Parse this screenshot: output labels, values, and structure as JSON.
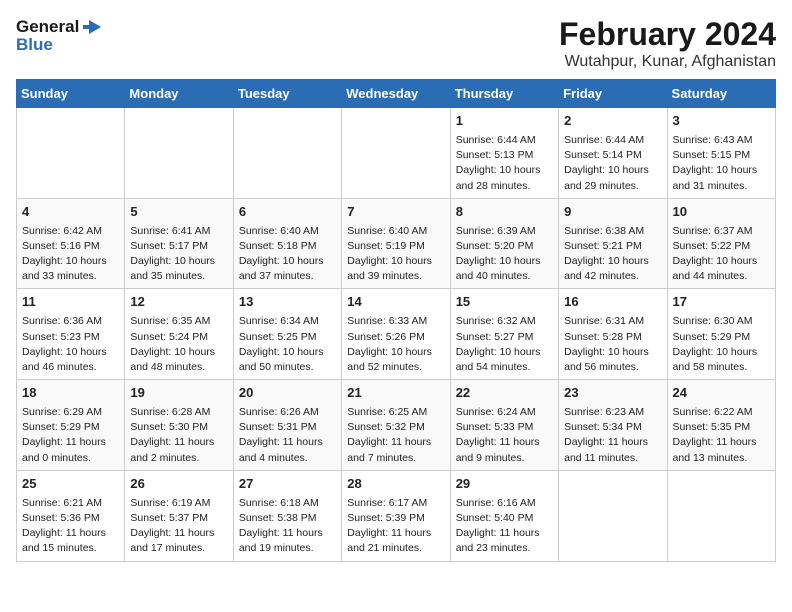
{
  "header": {
    "logo_line1": "General",
    "logo_line2": "Blue",
    "title": "February 2024",
    "subtitle": "Wutahpur, Kunar, Afghanistan"
  },
  "days_of_week": [
    "Sunday",
    "Monday",
    "Tuesday",
    "Wednesday",
    "Thursday",
    "Friday",
    "Saturday"
  ],
  "weeks": [
    [
      {
        "day": "",
        "sunrise": "",
        "sunset": "",
        "daylight": ""
      },
      {
        "day": "",
        "sunrise": "",
        "sunset": "",
        "daylight": ""
      },
      {
        "day": "",
        "sunrise": "",
        "sunset": "",
        "daylight": ""
      },
      {
        "day": "",
        "sunrise": "",
        "sunset": "",
        "daylight": ""
      },
      {
        "day": "1",
        "sunrise": "Sunrise: 6:44 AM",
        "sunset": "Sunset: 5:13 PM",
        "daylight": "Daylight: 10 hours and 28 minutes."
      },
      {
        "day": "2",
        "sunrise": "Sunrise: 6:44 AM",
        "sunset": "Sunset: 5:14 PM",
        "daylight": "Daylight: 10 hours and 29 minutes."
      },
      {
        "day": "3",
        "sunrise": "Sunrise: 6:43 AM",
        "sunset": "Sunset: 5:15 PM",
        "daylight": "Daylight: 10 hours and 31 minutes."
      }
    ],
    [
      {
        "day": "4",
        "sunrise": "Sunrise: 6:42 AM",
        "sunset": "Sunset: 5:16 PM",
        "daylight": "Daylight: 10 hours and 33 minutes."
      },
      {
        "day": "5",
        "sunrise": "Sunrise: 6:41 AM",
        "sunset": "Sunset: 5:17 PM",
        "daylight": "Daylight: 10 hours and 35 minutes."
      },
      {
        "day": "6",
        "sunrise": "Sunrise: 6:40 AM",
        "sunset": "Sunset: 5:18 PM",
        "daylight": "Daylight: 10 hours and 37 minutes."
      },
      {
        "day": "7",
        "sunrise": "Sunrise: 6:40 AM",
        "sunset": "Sunset: 5:19 PM",
        "daylight": "Daylight: 10 hours and 39 minutes."
      },
      {
        "day": "8",
        "sunrise": "Sunrise: 6:39 AM",
        "sunset": "Sunset: 5:20 PM",
        "daylight": "Daylight: 10 hours and 40 minutes."
      },
      {
        "day": "9",
        "sunrise": "Sunrise: 6:38 AM",
        "sunset": "Sunset: 5:21 PM",
        "daylight": "Daylight: 10 hours and 42 minutes."
      },
      {
        "day": "10",
        "sunrise": "Sunrise: 6:37 AM",
        "sunset": "Sunset: 5:22 PM",
        "daylight": "Daylight: 10 hours and 44 minutes."
      }
    ],
    [
      {
        "day": "11",
        "sunrise": "Sunrise: 6:36 AM",
        "sunset": "Sunset: 5:23 PM",
        "daylight": "Daylight: 10 hours and 46 minutes."
      },
      {
        "day": "12",
        "sunrise": "Sunrise: 6:35 AM",
        "sunset": "Sunset: 5:24 PM",
        "daylight": "Daylight: 10 hours and 48 minutes."
      },
      {
        "day": "13",
        "sunrise": "Sunrise: 6:34 AM",
        "sunset": "Sunset: 5:25 PM",
        "daylight": "Daylight: 10 hours and 50 minutes."
      },
      {
        "day": "14",
        "sunrise": "Sunrise: 6:33 AM",
        "sunset": "Sunset: 5:26 PM",
        "daylight": "Daylight: 10 hours and 52 minutes."
      },
      {
        "day": "15",
        "sunrise": "Sunrise: 6:32 AM",
        "sunset": "Sunset: 5:27 PM",
        "daylight": "Daylight: 10 hours and 54 minutes."
      },
      {
        "day": "16",
        "sunrise": "Sunrise: 6:31 AM",
        "sunset": "Sunset: 5:28 PM",
        "daylight": "Daylight: 10 hours and 56 minutes."
      },
      {
        "day": "17",
        "sunrise": "Sunrise: 6:30 AM",
        "sunset": "Sunset: 5:29 PM",
        "daylight": "Daylight: 10 hours and 58 minutes."
      }
    ],
    [
      {
        "day": "18",
        "sunrise": "Sunrise: 6:29 AM",
        "sunset": "Sunset: 5:29 PM",
        "daylight": "Daylight: 11 hours and 0 minutes."
      },
      {
        "day": "19",
        "sunrise": "Sunrise: 6:28 AM",
        "sunset": "Sunset: 5:30 PM",
        "daylight": "Daylight: 11 hours and 2 minutes."
      },
      {
        "day": "20",
        "sunrise": "Sunrise: 6:26 AM",
        "sunset": "Sunset: 5:31 PM",
        "daylight": "Daylight: 11 hours and 4 minutes."
      },
      {
        "day": "21",
        "sunrise": "Sunrise: 6:25 AM",
        "sunset": "Sunset: 5:32 PM",
        "daylight": "Daylight: 11 hours and 7 minutes."
      },
      {
        "day": "22",
        "sunrise": "Sunrise: 6:24 AM",
        "sunset": "Sunset: 5:33 PM",
        "daylight": "Daylight: 11 hours and 9 minutes."
      },
      {
        "day": "23",
        "sunrise": "Sunrise: 6:23 AM",
        "sunset": "Sunset: 5:34 PM",
        "daylight": "Daylight: 11 hours and 11 minutes."
      },
      {
        "day": "24",
        "sunrise": "Sunrise: 6:22 AM",
        "sunset": "Sunset: 5:35 PM",
        "daylight": "Daylight: 11 hours and 13 minutes."
      }
    ],
    [
      {
        "day": "25",
        "sunrise": "Sunrise: 6:21 AM",
        "sunset": "Sunset: 5:36 PM",
        "daylight": "Daylight: 11 hours and 15 minutes."
      },
      {
        "day": "26",
        "sunrise": "Sunrise: 6:19 AM",
        "sunset": "Sunset: 5:37 PM",
        "daylight": "Daylight: 11 hours and 17 minutes."
      },
      {
        "day": "27",
        "sunrise": "Sunrise: 6:18 AM",
        "sunset": "Sunset: 5:38 PM",
        "daylight": "Daylight: 11 hours and 19 minutes."
      },
      {
        "day": "28",
        "sunrise": "Sunrise: 6:17 AM",
        "sunset": "Sunset: 5:39 PM",
        "daylight": "Daylight: 11 hours and 21 minutes."
      },
      {
        "day": "29",
        "sunrise": "Sunrise: 6:16 AM",
        "sunset": "Sunset: 5:40 PM",
        "daylight": "Daylight: 11 hours and 23 minutes."
      },
      {
        "day": "",
        "sunrise": "",
        "sunset": "",
        "daylight": ""
      },
      {
        "day": "",
        "sunrise": "",
        "sunset": "",
        "daylight": ""
      }
    ]
  ]
}
